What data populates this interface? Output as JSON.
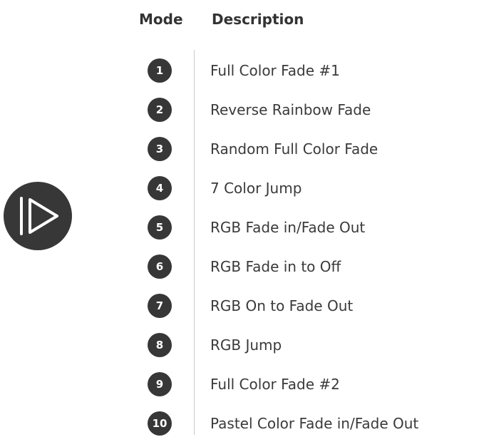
{
  "header": {
    "mode_label": "Mode",
    "description_label": "Description"
  },
  "play_icon": "play-icon",
  "colors": {
    "badge": "#373737",
    "text": "#333333",
    "divider": "#c9c9c9"
  },
  "modes": [
    {
      "number": "1",
      "description": "Full Color Fade #1"
    },
    {
      "number": "2",
      "description": "Reverse Rainbow Fade"
    },
    {
      "number": "3",
      "description": "Random Full Color Fade"
    },
    {
      "number": "4",
      "description": "7 Color Jump"
    },
    {
      "number": "5",
      "description": "RGB Fade in/Fade Out"
    },
    {
      "number": "6",
      "description": "RGB Fade in to Off"
    },
    {
      "number": "7",
      "description": "RGB On to Fade Out"
    },
    {
      "number": "8",
      "description": "RGB Jump"
    },
    {
      "number": "9",
      "description": "Full Color Fade #2"
    },
    {
      "number": "10",
      "description": "Pastel Color Fade in/Fade Out"
    }
  ]
}
